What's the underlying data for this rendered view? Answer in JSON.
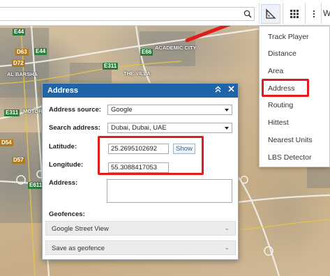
{
  "map": {
    "road_shields": [
      {
        "text": "E44",
        "kind": "e"
      },
      {
        "text": "D63",
        "kind": "d"
      },
      {
        "text": "E44",
        "kind": "e"
      },
      {
        "text": "D72",
        "kind": "d"
      },
      {
        "text": "E66",
        "kind": "e"
      },
      {
        "text": "E311",
        "kind": "e"
      },
      {
        "text": "E311",
        "kind": "e"
      },
      {
        "text": "D54",
        "kind": "d"
      },
      {
        "text": "D57",
        "kind": "d"
      },
      {
        "text": "E611",
        "kind": "e"
      }
    ],
    "labels": {
      "barsha": "AL BARSHA",
      "academic": "ACADEMIC CITY",
      "villa": "THE VILLA",
      "motor": "MOTOR"
    }
  },
  "toolbar": {
    "search_icon": "search-icon",
    "ruler_icon": "ruler-icon",
    "grid_icon": "grid-icon",
    "more_icon": "more-vertical-icon",
    "right_text": "W"
  },
  "menu": {
    "items": [
      "Track Player",
      "Distance",
      "Area",
      "Address",
      "Routing",
      "Hittest",
      "Nearest Units",
      "LBS Detector"
    ],
    "selected": "Address"
  },
  "dialog": {
    "title": "Address",
    "address_source_label": "Address source:",
    "address_source_value": "Google",
    "search_address_label": "Search address:",
    "search_address_value": "Dubai, Dubai, UAE",
    "latitude_label": "Latitude:",
    "latitude_value": "25.2695102692",
    "show_button": "Show",
    "longitude_label": "Longitude:",
    "longitude_value": "55.3088417053",
    "address_label": "Address:",
    "geofences_label": "Geofences:",
    "street_view_label": "Google Street View",
    "save_geofence_label": "Save as geofence",
    "collapse_icon": "double-chevron-up-icon",
    "close_icon": "close-icon"
  },
  "colors": {
    "header": "#1f63a8",
    "highlight": "#e01b1b"
  }
}
